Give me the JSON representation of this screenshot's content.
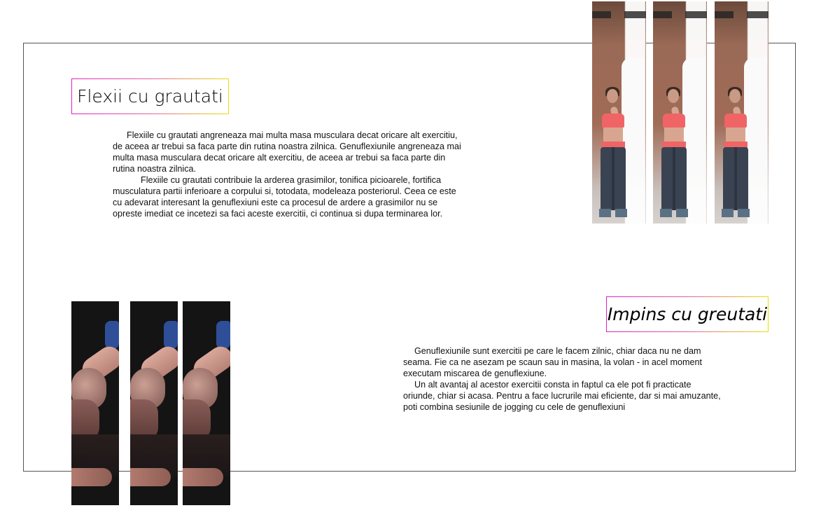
{
  "section1": {
    "title": "Flexii cu grautati",
    "paragraphs": [
      "      Flexiile cu grautati angreneaza mai multa masa musculara decat oricare alt exercitiu, de aceea  ar trebui sa faca parte din rutina noastra zilnica. Genuflexiunile angreneaza mai multa masa musculara decat oricare alt exercitiu, de aceea ar trebui sa faca parte din rutina noastra zilnica.",
      "            Flexiile cu grautati contribuie la arderea grasimilor, tonifica picioarele, fortifica musculatura partii inferioare a corpului si, totodata, modeleaza posteriorul. Ceea ce este cu adevarat interesant la genuflexiuni este ca procesul de ardere a grasimilor nu se opreste imediat ce incetezi sa faci aceste exercitii, ci continua si dupa terminarea lor."
    ]
  },
  "section2": {
    "title": "Impins cu greutati",
    "paragraphs": [
      "     Genuflexiunile sunt exercitii pe care le facem zilnic, chiar daca nu ne dam seama. Fie ca ne asezam pe scaun sau in masina, la volan - in acel moment executam miscarea de genuflexiune.",
      "     Un alt avantaj al acestor exercitii consta in faptul ca ele pot fi practicate oriunde, chiar si acasa. Pentru a face lucrurile mai eficiente, dar si mai amuzante, poti combina sesiunile de jogging cu cele de genuflexiuni"
    ]
  }
}
